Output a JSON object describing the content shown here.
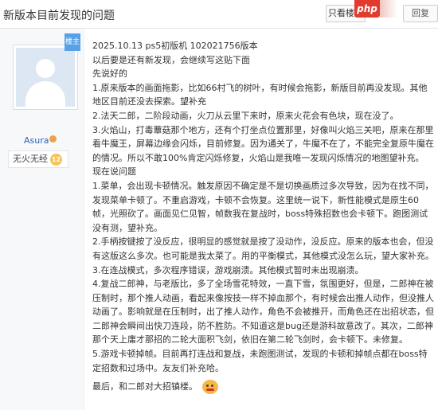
{
  "header": {
    "title": "新版本目前发现的问题",
    "only_louzhu": "只看楼主",
    "php_badge": "php",
    "reply": "回复"
  },
  "author": {
    "louzhu_tag": "楼主",
    "username": "Asura",
    "level_name": "无火无经",
    "level_num": "12"
  },
  "post": {
    "lines": [
      "2025.10.13 ps5初版机 102021756版本",
      "以后要是还有新发现，会继续写这贴下面",
      "先说好的",
      "1.原来版本的画面拖影，比如66村飞的树叶，有时候会拖影，新版目前再没发现。其他地区目前还没去探索。望补充",
      "2.法天二郎，二阶段动画，火刀从云里下来时，原来火花会有色块，现在没了。",
      "3.火焰山，打毒蕈菇那个地方，还有个打坐点位置那里，好像叫火焰三关吧，原来在那里看牛魔王，屏幕边缘会闪烁，目前修复。因为通关了，牛魔不在了，不能完全复原牛魔在的情况。所以不敢100%肯定闪烁修复，火焰山是我唯一发现闪烁情况的地图望补充。",
      "现在说问题",
      "1.菜单，会出现卡顿情况。触发原因不确定是不是切换画质过多次导致，因为在找不同，发现菜单卡顿了。不重启游戏，卡顿不会恢复。这里统一说下，新性能模式是原生60帧，光照砍了。画面见仁见智，帧数我在复战时，boss特殊招数也会卡顿下。跑图测试没有测，望补充。",
      "2.手柄按键按了没反应，很明显的感觉就是按了没动作，没反应。原来的版本也会，但没有这版这么多次。也可能是我太菜了。用的平衡模式，其他模式没怎么玩，望大家补充。",
      "3.在连战模式，多次程序错误，游戏崩溃。其他模式暂时未出现崩溃。",
      "4.复战二郎神，与老版比，多了全场雪花特效，一直下雪，氛围更好，但是，二郎神在被压制时，那个推人动画，看起来像按技一样不掉血那个，有时候会出推人动作，但没推人动画了。影响就是在压制时，出了推人动作，角色不会被推开，而角色还在出招状态，但二郎神会瞬间出快刀连段，防不胜防。不知道这是bug还是游科故意改了。其次，二郎神那个天上庸才那招的二轮大面积飞剑，依旧在第二轮飞剑时，会卡顿下。未修复。",
      "5.游戏卡顿掉帧。目前再打连战和复战，未跑图测试，发现的卡顿和掉帧点都在boss特定招数和过场中。友友们补充哈。"
    ],
    "last_line": "最后，和二郎对大招镇楼。"
  }
}
